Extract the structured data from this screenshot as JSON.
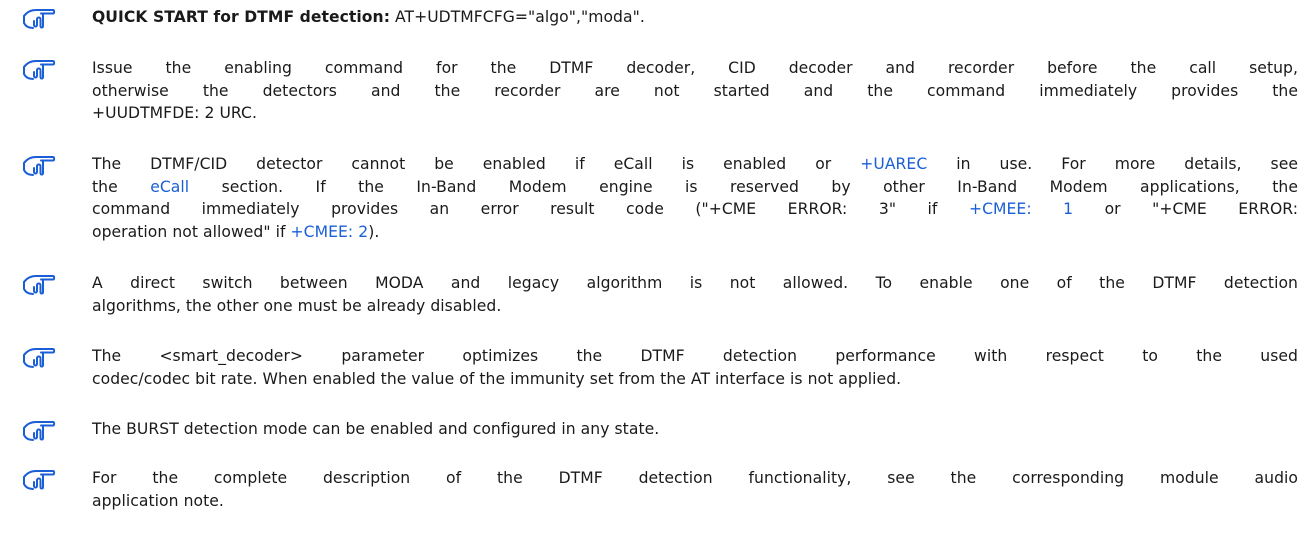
{
  "notes": [
    {
      "lines": [
        [
          {
            "t": "QUICK START for DTMF detection:",
            "b": true
          },
          {
            "t": " AT+UDTMFCFG=\"algo\",\"moda\"."
          }
        ]
      ]
    },
    {
      "lines": [
        [
          {
            "t": "Issue the enabling command for the DTMF decoder, CID decoder and recorder before the call setup,"
          }
        ],
        [
          {
            "t": " otherwise the detectors and the recorder are not started and the command immediately provides the"
          }
        ],
        [
          {
            "t": "+UUDTMFDE: 2 URC."
          }
        ]
      ]
    },
    {
      "lines": [
        [
          {
            "t": "The DTMF/CID detector cannot be enabled if eCall is enabled or "
          },
          {
            "t": "+UAREC",
            "link": true
          },
          {
            "t": " in use. For more details, see"
          }
        ],
        [
          {
            "t": "the "
          },
          {
            "t": "eCall",
            "link": true
          },
          {
            "t": " section. If the In-Band Modem engine is reserved by other In-Band Modem applications, the"
          }
        ],
        [
          {
            "t": "command immediately provides an error result code (\"+CME ERROR: 3\" if "
          },
          {
            "t": "+CMEE: 1",
            "link": true
          },
          {
            "t": " or \"+CME ERROR:"
          }
        ],
        [
          {
            "t": "operation not allowed\" if "
          },
          {
            "t": "+CMEE: 2",
            "link": true
          },
          {
            "t": ")."
          }
        ]
      ]
    },
    {
      "lines": [
        [
          {
            "t": "A direct switch between MODA and legacy algorithm is not allowed. To enable one of the DTMF detection"
          }
        ],
        [
          {
            "t": "algorithms, the other one must be already disabled."
          }
        ]
      ]
    },
    {
      "lines": [
        [
          {
            "t": "The <smart_decoder> parameter optimizes the DTMF detection performance with respect to the used"
          }
        ],
        [
          {
            "t": "codec/codec bit rate. When enabled the value of the immunity set from the AT interface is not applied."
          }
        ]
      ]
    },
    {
      "lines": [
        [
          {
            "t": "The BURST detection mode can be enabled and configured in any state."
          }
        ]
      ]
    },
    {
      "lines": [
        [
          {
            "t": "For the complete description of the DTMF detection functionality, see the corresponding module audio"
          }
        ],
        [
          {
            "t": "application note."
          }
        ]
      ]
    }
  ],
  "icon_name": "pointing-hand-icon",
  "colors": {
    "icon": "#1a5fd6",
    "link": "#1a5fd6",
    "text": "#1a1a1a"
  }
}
